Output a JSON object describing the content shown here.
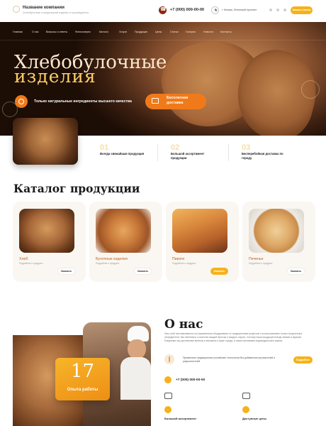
{
  "header": {
    "company_name": "Название компании",
    "company_sub": "Хлебобулочные и кондитерские изделия от производителя",
    "phone": "+7 (000) 000-00-00",
    "address": "г. Москва, Ленинский проспект",
    "cta": "Заказать звонок"
  },
  "nav": [
    "Главная",
    "О нас",
    "Вопросы и ответы",
    "Фотогалерея",
    "Каталог",
    "Услуги",
    "Продукция",
    "Цены",
    "Статьи",
    "Галерея",
    "Новости",
    "Контакты"
  ],
  "hero": {
    "title_line1": "Хлебобулочные",
    "title_line2": "изделия",
    "natural": "Только натуральные ингредиенты высшего качества",
    "delivery": "Бесплатная доставка"
  },
  "features": [
    {
      "num": "01",
      "text": "Всегда свежайшая продукция"
    },
    {
      "num": "02",
      "text": "Большой ассортимент продукции"
    },
    {
      "num": "03",
      "text": "Бесперебойная доставка по городу"
    }
  ],
  "catalog": {
    "title": "Каталог продукции",
    "items": [
      {
        "name": "Хлеб",
        "sub": "Подробнее о продукте",
        "button": "Заказать",
        "active": false
      },
      {
        "name": "Булочные изделия",
        "sub": "Подробнее о продукте",
        "button": "Заказать",
        "active": false
      },
      {
        "name": "Пироги",
        "sub": "Подробнее о продукте",
        "button": "Заказать",
        "active": true
      },
      {
        "name": "Печенье",
        "sub": "Подробнее о продукте",
        "button": "Заказать",
        "active": false
      }
    ]
  },
  "about": {
    "title": "О нас",
    "text": "Наш хлеб изготавливается на современном оборудовании по традиционным рецептам с использованием только натуральных ингредиентов. Мы заботимся о качестве каждой булочки и каждого пирога, поэтому наша продукция всегда свежая и вкусная. Ежедневно мы доставляем выпечку в магазины и кафе города, а также принимаем индивидуальные заказы.",
    "experience_num": "17",
    "experience_label": "Опыта работы",
    "tradition": "Применяем традиционные российские технологии без добавления улучшителей и разрыхлителей",
    "more_button": "Подробнее",
    "phone": "+7 (000) 000-00-00",
    "feature1": "Большой ассортимент",
    "feature2": "Доступные цены"
  }
}
